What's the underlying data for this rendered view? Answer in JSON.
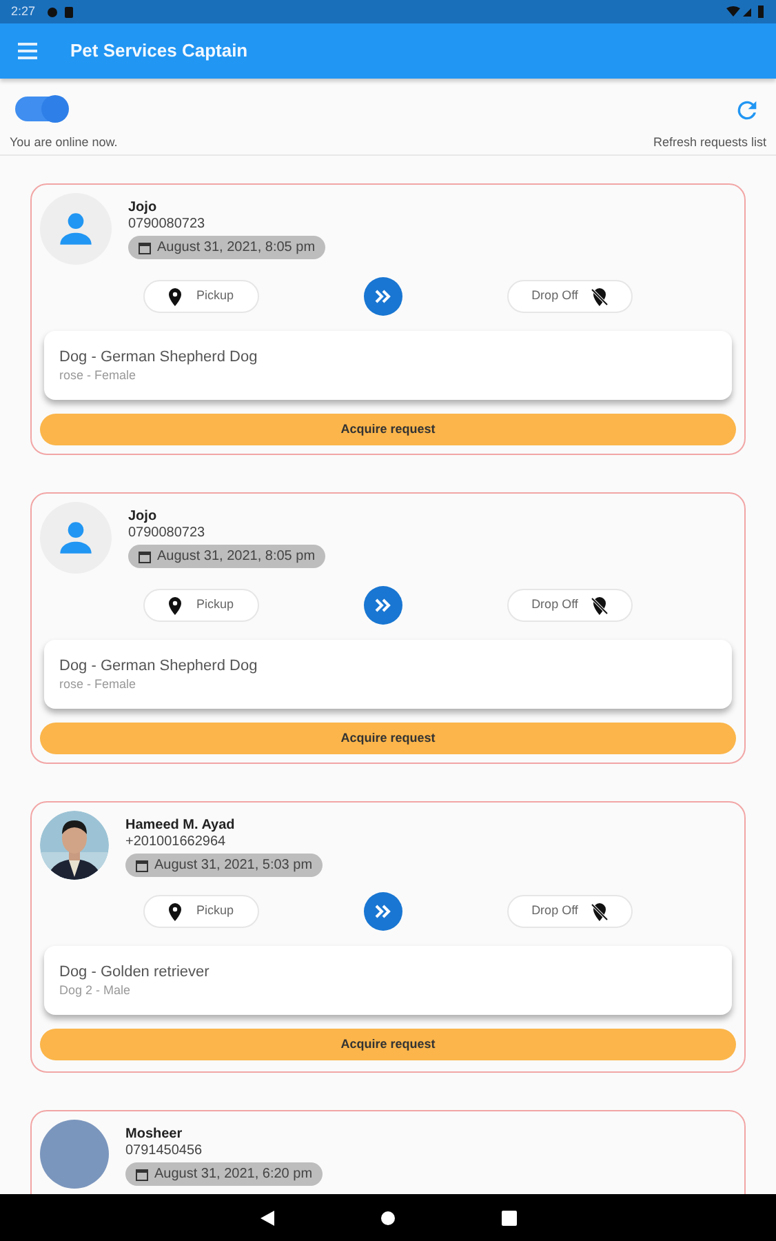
{
  "status_bar": {
    "time": "2:27"
  },
  "app_bar": {
    "title": "Pet Services Captain"
  },
  "online": {
    "on": true,
    "label": "You are online now."
  },
  "refresh": {
    "label": "Refresh requests list"
  },
  "requests": [
    {
      "name": "Jojo",
      "phone": "0790080723",
      "date": "August 31, 2021, 8:05 pm",
      "avatar": {
        "kind": "default"
      },
      "pickup": "Pickup",
      "dropoff": "Drop Off",
      "pet": "Dog - German Shepherd Dog",
      "pet_details": "rose - Female",
      "action": "Acquire request"
    },
    {
      "name": "Jojo",
      "phone": "0790080723",
      "date": "August 31, 2021, 8:05 pm",
      "avatar": {
        "kind": "default"
      },
      "pickup": "Pickup",
      "dropoff": "Drop Off",
      "pet": "Dog - German Shepherd Dog",
      "pet_details": "rose - Female",
      "action": "Acquire request"
    },
    {
      "name": "Hameed M. Ayad",
      "phone": "+201001662964",
      "date": "August 31, 2021, 5:03 pm",
      "pickup": "Pickup",
      "dropoff": "Drop Off",
      "pet": "Dog - Golden retriever",
      "pet_details": "Dog 2 - Male",
      "action": "Acquire request"
    },
    {
      "name": "Mosheer",
      "phone": "0791450456",
      "date": "August 31, 2021, 6:20 pm",
      "avatar": {
        "kind": "color",
        "color": "#7b96bd"
      }
    }
  ]
}
